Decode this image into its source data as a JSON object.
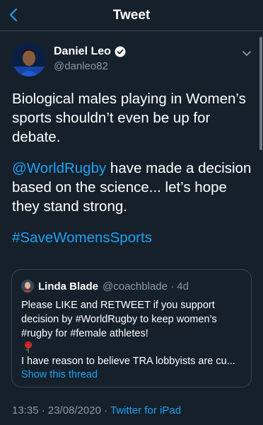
{
  "header": {
    "title": "Tweet"
  },
  "author": {
    "name": "Daniel Leo",
    "handle": "@danleo82",
    "verified": true
  },
  "tweet": {
    "paragraph1": "Biological males playing in Women’s sports shouldn’t even be up for debate.",
    "paragraph2_mention": "@WorldRugby",
    "paragraph2_text": " have made a decision based on the science... let’s hope they stand strong.",
    "hashtag": "#SaveWomensSports"
  },
  "quoted": {
    "name": "Linda Blade",
    "meta": "@coachblade · 4d",
    "line1": "Please LIKE and RETWEET if you support decision by #WorldRugby to keep women’s #rugby for #female athletes!",
    "line2": "I have reason to believe TRA lobbyists are cu...",
    "show_thread": "Show this thread"
  },
  "footer": {
    "timestamp": "13:35 · 23/08/2020 · ",
    "source": "Twitter for iPad"
  },
  "colors": {
    "background": "#15202b",
    "accent": "#1da1f2",
    "secondary_text": "#8899a6",
    "border": "#38444d"
  },
  "icons": [
    "back-arrow-icon",
    "verified-badge-icon",
    "chevron-down-icon",
    "rose-emoji-icon"
  ]
}
